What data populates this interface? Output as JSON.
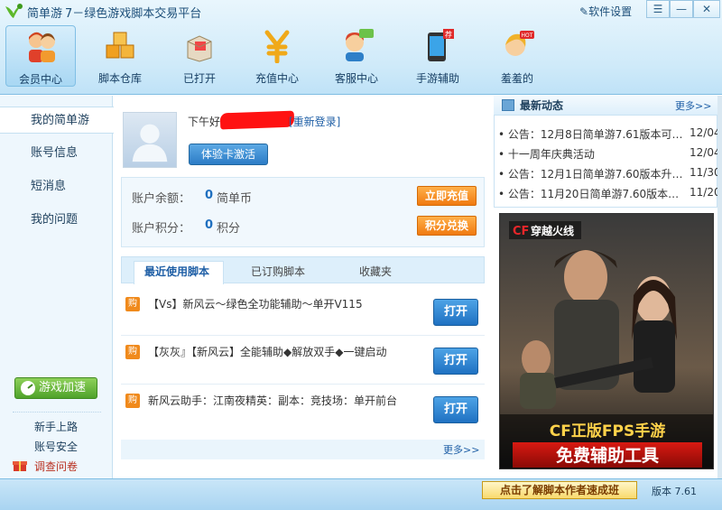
{
  "titlebar": {
    "app_name": "简单游",
    "slogan": "7－绿色游戏脚本交易平台",
    "settings": "软件设置"
  },
  "nav": [
    {
      "label": "会员中心",
      "icon": "member-center-icon",
      "active": true
    },
    {
      "label": "脚本仓库",
      "icon": "script-warehouse-icon",
      "active": false
    },
    {
      "label": "已打开",
      "icon": "opened-box-icon",
      "active": false
    },
    {
      "label": "充值中心",
      "icon": "yen-icon",
      "active": false
    },
    {
      "label": "客服中心",
      "icon": "customer-service-icon",
      "active": false
    },
    {
      "label": "手游辅助",
      "icon": "phone-icon",
      "active": false,
      "badge": "荐"
    },
    {
      "label": "羞羞的",
      "icon": "girl-icon",
      "active": false,
      "badge": "HOT"
    }
  ],
  "sidebar": {
    "items": [
      "我的简单游",
      "账号信息",
      "短消息",
      "我的问题"
    ],
    "speed_button": "游戏加速",
    "links": [
      "新手上路",
      "账号安全",
      "调查问卷"
    ]
  },
  "user": {
    "greeting": "下午好",
    "relogin": "[重新登录]",
    "trial_button": "体验卡激活"
  },
  "account": {
    "balance_label": "账户余额：",
    "balance_value": "0",
    "balance_unit": "简单币",
    "recharge_button": "立即充值",
    "points_label": "账户积分：",
    "points_value": "0",
    "points_unit": "积分",
    "exchange_button": "积分兑换"
  },
  "tabs": [
    "最近使用脚本",
    "已订购脚本",
    "收藏夹"
  ],
  "scripts": [
    {
      "icon_text": "购",
      "title": "【Vs】新风云～绿色全功能辅助～单开V115",
      "button": "打开"
    },
    {
      "icon_text": "购",
      "title": "【灰灰』【新风云】全能辅助◆解放双手◆一键启动",
      "button": "打开"
    },
    {
      "icon_text": "购",
      "title": "新风云助手：江南夜精英：副本：竞技场：单开前台",
      "button": "打开"
    }
  ],
  "scripts_more": "更多>>",
  "news": {
    "title": "最新动态",
    "more": "更多>>",
    "items": [
      {
        "text": "公告：12月8日简单游7.61版本可…",
        "date": "12/04"
      },
      {
        "text": "十一周年庆典活动",
        "date": "12/04"
      },
      {
        "text": "公告：12月1日简单游7.60版本升…",
        "date": "11/30"
      },
      {
        "text": "公告：11月20日简单游7.60版本…",
        "date": "11/20"
      }
    ]
  },
  "banner": {
    "top_logo": "穿越火线",
    "line1": "CF正版FPS手游",
    "line2": "免费辅助工具"
  },
  "statusbar": {
    "promo": "点击了解脚本作者速成班",
    "version": "版本 7.61"
  }
}
